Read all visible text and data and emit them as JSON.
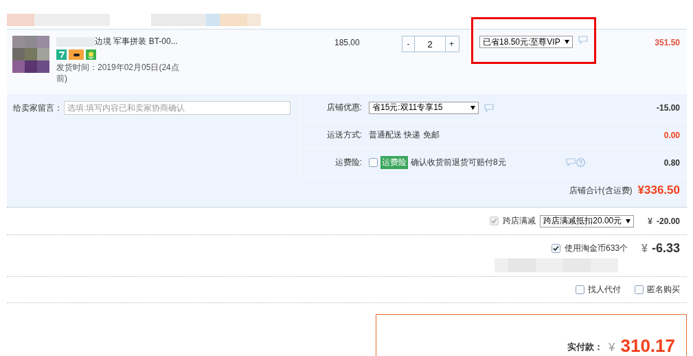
{
  "product": {
    "title": "边境 军事拼装 BT-00...",
    "ship_time": "发货时间：2019年02月05日(24点前)",
    "price": "185.00",
    "qty_minus": "-",
    "quantity": "2",
    "qty_plus": "+",
    "promo": "已省18.50元:至尊VIP",
    "promo_highlighted": true,
    "subtotal": "351.50"
  },
  "message": {
    "label": "给卖家留言：",
    "placeholder": "选填:填写内容已和卖家协商确认"
  },
  "shop_options": [
    {
      "kind": "select",
      "label": "店铺优惠:",
      "value": "省15元:双11专享15",
      "amount": "-15.00",
      "highlight": false
    },
    {
      "kind": "text",
      "label": "运送方式:",
      "value": "普通配送 快递 免邮",
      "amount": "0.00",
      "highlight": true
    },
    {
      "kind": "insurance",
      "label": "运费险:",
      "checked": false,
      "tag": "运费险",
      "value": "确认收货前退货可赔付8元",
      "amount": "0.80",
      "highlight": false
    }
  ],
  "shop_total": {
    "label": "店铺合计(含运费)",
    "amount": "¥336.50"
  },
  "discounts": [
    {
      "kind": "select",
      "checked": true,
      "disabled": true,
      "label": "跨店满减",
      "value": "跨店满减抵扣20.00元",
      "currency": "¥",
      "amount": "-20.00"
    },
    {
      "kind": "coins",
      "checked": true,
      "disabled": false,
      "label": "使用淘金币633个",
      "currency": "¥",
      "amount": "-6.33"
    }
  ],
  "options": [
    {
      "label": "找人代付",
      "checked": false
    },
    {
      "label": "匿名购买",
      "checked": false
    }
  ],
  "payment": {
    "label": "实付款：",
    "currency": "¥",
    "amount": "310.17"
  }
}
